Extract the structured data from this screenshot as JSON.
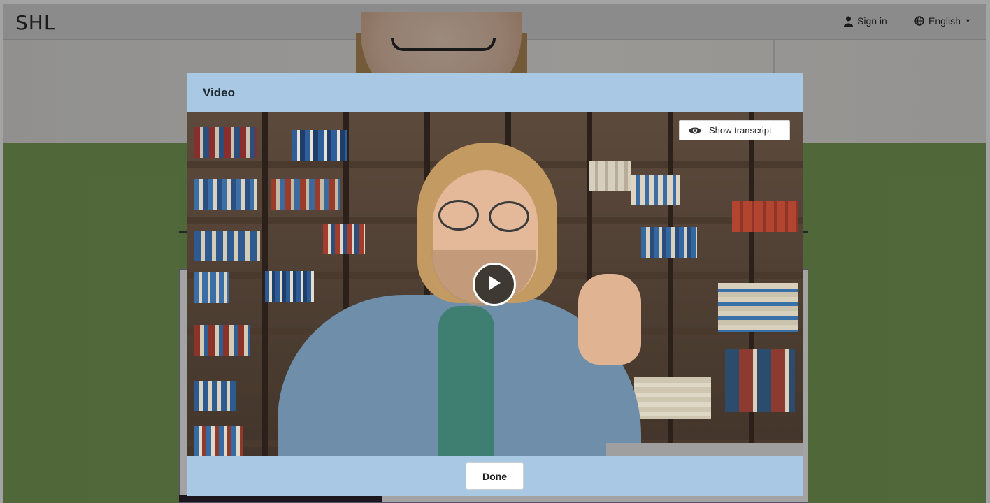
{
  "header": {
    "logo_text": "SHL",
    "logo_dot": ".",
    "signin_label": "Sign in",
    "language_label": "English",
    "icons": {
      "signin": "user-icon",
      "language": "globe-icon",
      "language_caret": "chevron-down-icon"
    }
  },
  "modal": {
    "title": "Video",
    "show_transcript_label": "Show transcript",
    "show_transcript_icon": "eye-icon",
    "play_icon": "play-icon",
    "done_label": "Done"
  },
  "colors": {
    "modal_bg": "#a8c8e4",
    "page_green": "#7ea35a",
    "overlay": "rgba(0,0,0,0.36)"
  }
}
